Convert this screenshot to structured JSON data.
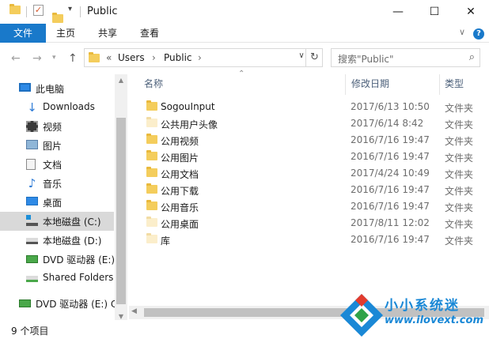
{
  "window": {
    "title": "Public",
    "controls": {
      "minimize": "—",
      "maximize": "☐",
      "close": "✕"
    }
  },
  "ribbon": {
    "tabs": [
      {
        "label": "文件",
        "active": true
      },
      {
        "label": "主页"
      },
      {
        "label": "共享"
      },
      {
        "label": "查看"
      }
    ],
    "help": "?",
    "accent_color": "#1979ca"
  },
  "address": {
    "overflow": "«",
    "segments": [
      "Users",
      "Public"
    ],
    "separator": "›"
  },
  "search": {
    "placeholder": "搜索\"Public\""
  },
  "nav_pane": {
    "items": [
      {
        "label": "此电脑",
        "icon": "computer-icon"
      },
      {
        "label": "Downloads",
        "icon": "download-icon"
      },
      {
        "label": "视频",
        "icon": "video-icon"
      },
      {
        "label": "图片",
        "icon": "pictures-icon"
      },
      {
        "label": "文档",
        "icon": "document-icon"
      },
      {
        "label": "音乐",
        "icon": "music-icon"
      },
      {
        "label": "桌面",
        "icon": "desktop-icon"
      },
      {
        "label": "本地磁盘 (C:)",
        "icon": "drive-c-icon",
        "selected": true
      },
      {
        "label": "本地磁盘 (D:)",
        "icon": "drive-icon"
      },
      {
        "label": "DVD 驱动器 (E:)",
        "icon": "dvd-icon"
      },
      {
        "label": "Shared Folders",
        "icon": "network-drive-icon"
      },
      {
        "label": "DVD 驱动器 (E:) C",
        "icon": "dvd-icon"
      }
    ]
  },
  "file_list": {
    "columns": {
      "name": "名称",
      "date": "修改日期",
      "type": "类型"
    },
    "rows": [
      {
        "name": "SogouInput",
        "date": "2017/6/13 10:50",
        "type": "文件夹",
        "pale": false
      },
      {
        "name": "公共用户头像",
        "date": "2017/6/14 8:42",
        "type": "文件夹",
        "pale": true
      },
      {
        "name": "公用视频",
        "date": "2016/7/16 19:47",
        "type": "文件夹",
        "pale": false
      },
      {
        "name": "公用图片",
        "date": "2016/7/16 19:47",
        "type": "文件夹",
        "pale": false
      },
      {
        "name": "公用文档",
        "date": "2017/4/24 10:49",
        "type": "文件夹",
        "pale": false
      },
      {
        "name": "公用下载",
        "date": "2016/7/16 19:47",
        "type": "文件夹",
        "pale": false
      },
      {
        "name": "公用音乐",
        "date": "2016/7/16 19:47",
        "type": "文件夹",
        "pale": false
      },
      {
        "name": "公用桌面",
        "date": "2017/8/11 12:02",
        "type": "文件夹",
        "pale": true
      },
      {
        "name": "库",
        "date": "2016/7/16 19:47",
        "type": "文件夹",
        "pale": true
      }
    ]
  },
  "status_bar": {
    "item_count": "9 个项目"
  },
  "watermark": {
    "title": "小小系统迷",
    "url": "www.ilovext.com"
  }
}
